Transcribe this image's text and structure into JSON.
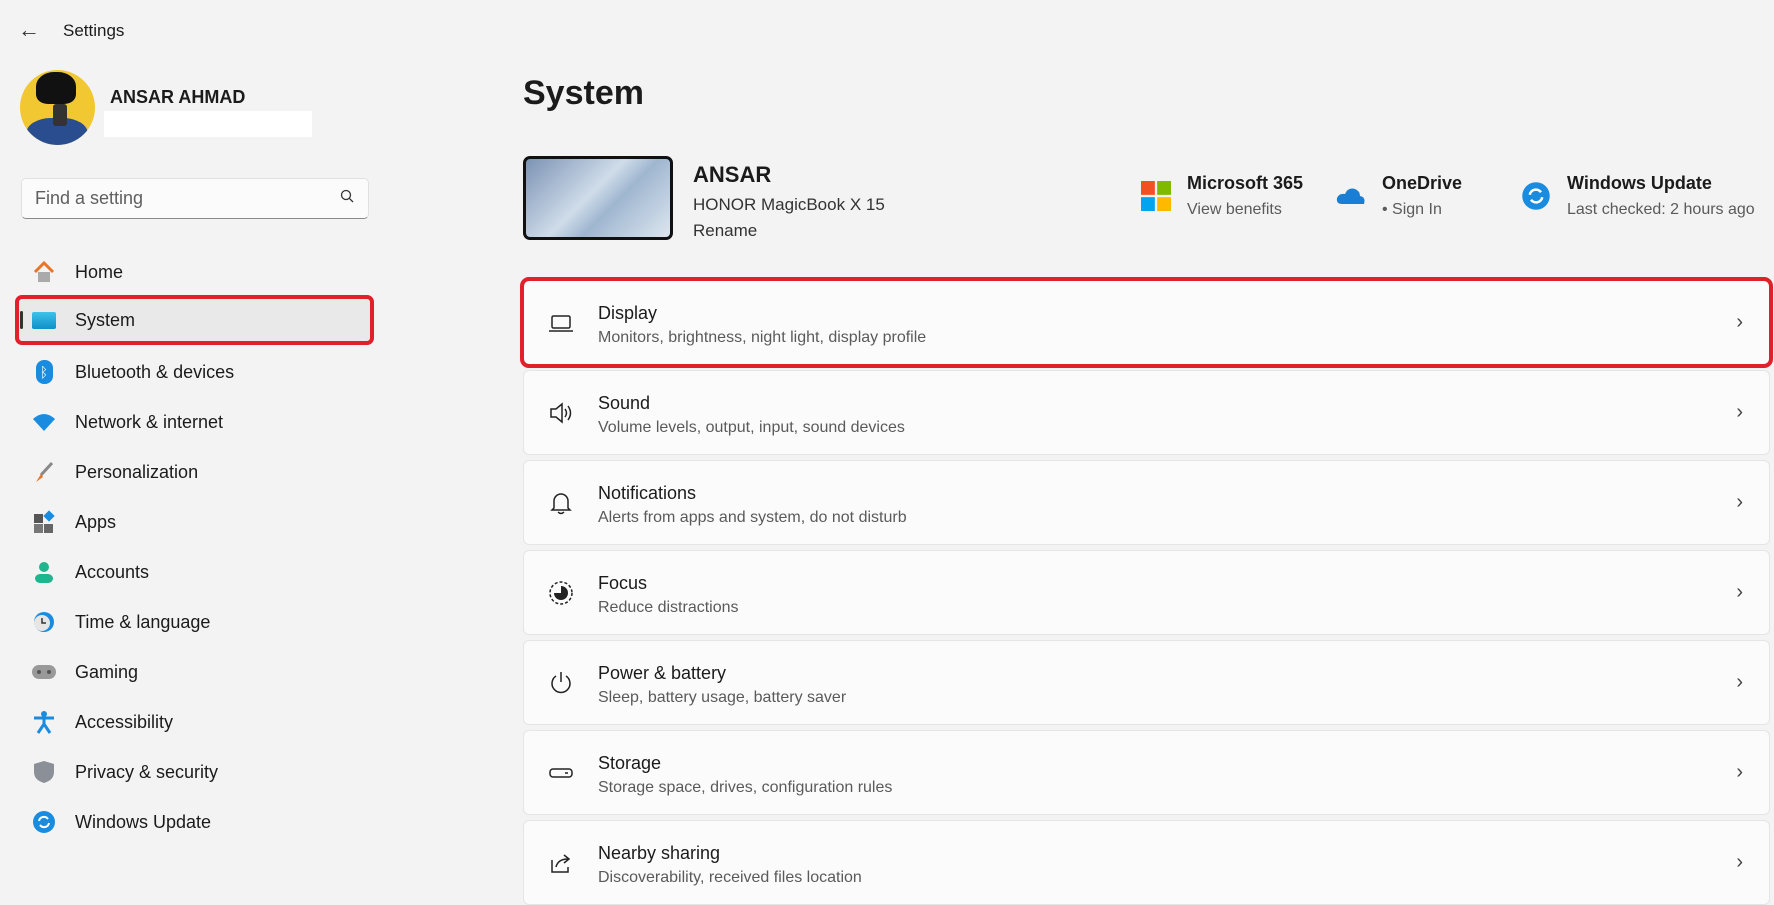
{
  "app": {
    "title": "Settings"
  },
  "user": {
    "name": "ANSAR AHMAD"
  },
  "search": {
    "placeholder": "Find a setting"
  },
  "nav": [
    {
      "label": "Home",
      "icon": "home-icon"
    },
    {
      "label": "System",
      "icon": "system-icon",
      "selected": true
    },
    {
      "label": "Bluetooth & devices",
      "icon": "bluetooth-icon"
    },
    {
      "label": "Network & internet",
      "icon": "wifi-icon"
    },
    {
      "label": "Personalization",
      "icon": "brush-icon"
    },
    {
      "label": "Apps",
      "icon": "apps-icon"
    },
    {
      "label": "Accounts",
      "icon": "account-icon"
    },
    {
      "label": "Time & language",
      "icon": "clock-globe-icon"
    },
    {
      "label": "Gaming",
      "icon": "gamepad-icon"
    },
    {
      "label": "Accessibility",
      "icon": "accessibility-icon"
    },
    {
      "label": "Privacy & security",
      "icon": "shield-icon"
    },
    {
      "label": "Windows Update",
      "icon": "update-icon"
    }
  ],
  "page": {
    "title": "System"
  },
  "device": {
    "name": "ANSAR",
    "model": "HONOR MagicBook X 15",
    "rename": "Rename"
  },
  "info": [
    {
      "title": "Microsoft 365",
      "sub": "View benefits"
    },
    {
      "title": "OneDrive",
      "sub": "• Sign In"
    },
    {
      "title": "Windows Update",
      "sub": "Last checked: 2 hours ago"
    }
  ],
  "cards": [
    {
      "title": "Display",
      "sub": "Monitors, brightness, night light, display profile"
    },
    {
      "title": "Sound",
      "sub": "Volume levels, output, input, sound devices"
    },
    {
      "title": "Notifications",
      "sub": "Alerts from apps and system, do not disturb"
    },
    {
      "title": "Focus",
      "sub": "Reduce distractions"
    },
    {
      "title": "Power & battery",
      "sub": "Sleep, battery usage, battery saver"
    },
    {
      "title": "Storage",
      "sub": "Storage space, drives, configuration rules"
    },
    {
      "title": "Nearby sharing",
      "sub": "Discoverability, received files location"
    }
  ],
  "colors": {
    "highlight": "#e0202a",
    "accent": "#0078d4"
  }
}
